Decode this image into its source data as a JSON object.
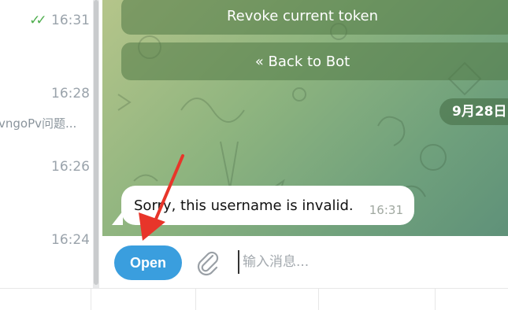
{
  "chat_list": {
    "times": [
      "16:31",
      "16:28",
      "16:26",
      "16:24"
    ],
    "preview": "vngoPv问题..."
  },
  "chat": {
    "inline_buttons": [
      "Revoke current token",
      "« Back to Bot"
    ],
    "date_badge": "9月28日",
    "message": {
      "text": "Sorry, this username is invalid.",
      "time": "16:31"
    }
  },
  "composer": {
    "open_label": "Open",
    "input_placeholder": "输入消息..."
  },
  "colors": {
    "accent": "#3a9ede",
    "annotation_arrow": "#e8352a",
    "read_ticks": "#4fae4e"
  },
  "icons": [
    "double-check-icon",
    "paperclip-icon"
  ]
}
